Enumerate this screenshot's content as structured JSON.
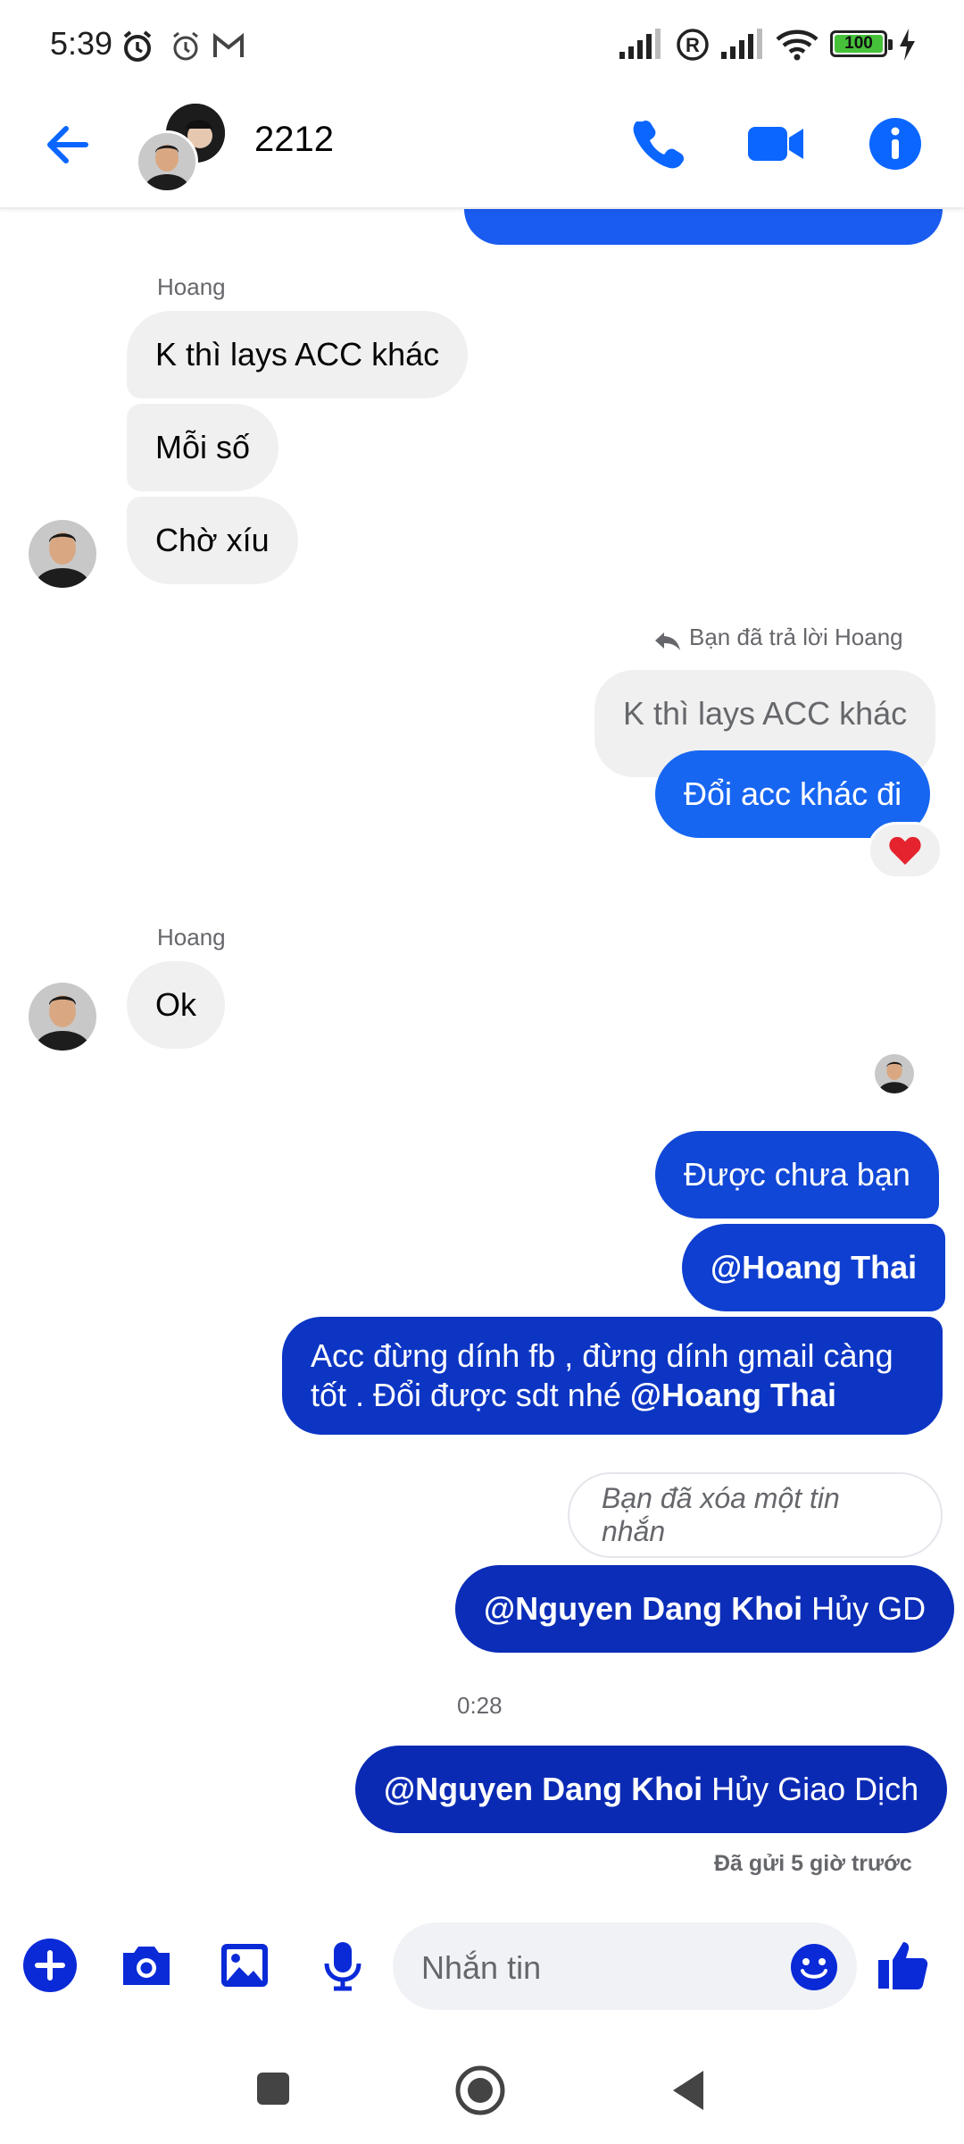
{
  "status_bar": {
    "time": "5:39",
    "battery": "100"
  },
  "header": {
    "title": "2212",
    "icons": [
      "back-arrow-icon",
      "phone-icon",
      "video-call-icon",
      "info-icon"
    ]
  },
  "messages": {
    "sender1": "Hoang",
    "in1": "K thì lays ACC khác",
    "in2": "Mỗi số",
    "in3": "Chờ xíu",
    "reply_note": "Bạn đã trả lời Hoang",
    "quoted": "K thì lays ACC khác",
    "out1": "Đổi acc khác đi",
    "reaction": "❤️",
    "sender2": "Hoang",
    "in4": "Ok",
    "out2": "Được chưa bạn",
    "out3": "@Hoang Thai",
    "out4_line1": "Acc đừng dính fb , đừng dính gmail càng",
    "out4_line2": "tốt . Đổi được sdt nhé ",
    "out4_mention": "@Hoang Thai",
    "deleted": "Bạn đã xóa một tin nhắn",
    "out5_mention": "@Nguyen Dang Khoi",
    "out5_text": " Hủy GD",
    "time": "0:28",
    "out6_mention": "@Nguyen Dang Khoi",
    "out6_text": " Hủy Giao Dịch",
    "sent_note": "Đã gửi 5 giờ trước"
  },
  "composer": {
    "placeholder": "Nhắn tin"
  },
  "colors": {
    "accent": "#0a66ff",
    "outgoing_top": "#1a5cf0",
    "outgoing_bottom": "#0b2bb8",
    "incoming": "#f0f0f0"
  }
}
